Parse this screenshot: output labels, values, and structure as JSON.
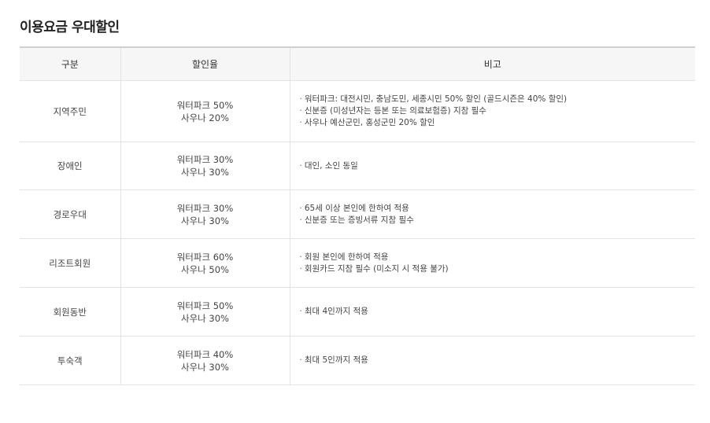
{
  "title": "이용요금 우대할인",
  "headers": {
    "category": "구분",
    "rate": "할인율",
    "note": "비고"
  },
  "bullet_char": "·",
  "rows": [
    {
      "category": "지역주민",
      "rate": [
        "워터파크 50%",
        "사우나 20%"
      ],
      "notes": [
        "워터파크: 대전시민, 충남도민, 세종시민 50% 할인 (골드시즌은 40% 할인)",
        "신분증 (미성년자는 등본 또는 의료보험증) 지참 필수",
        "사우나 예산군민, 홍성군민 20% 할인"
      ]
    },
    {
      "category": "장애인",
      "rate": [
        "워터파크 30%",
        "사우나 30%"
      ],
      "notes": [
        "대인, 소인 동일"
      ]
    },
    {
      "category": "경로우대",
      "rate": [
        "워터파크 30%",
        "사우나 30%"
      ],
      "notes": [
        "65세 이상 본인에 한하여 적용",
        "신분증 또는 증빙서류 지참 필수"
      ]
    },
    {
      "category": "리조트회원",
      "rate": [
        "워터파크 60%",
        "사우나 50%"
      ],
      "notes": [
        "회원 본인에 한하여 적용",
        "회원카드 지참 필수 (미소지 시 적용 불가)"
      ]
    },
    {
      "category": "회원동반",
      "rate": [
        "워터파크 50%",
        "사우나 30%"
      ],
      "notes": [
        "최대 4인까지 적용"
      ]
    },
    {
      "category": "투숙객",
      "rate": [
        "워터파크 40%",
        "사우나 30%"
      ],
      "notes": [
        "최대 5인까지 적용"
      ]
    }
  ]
}
